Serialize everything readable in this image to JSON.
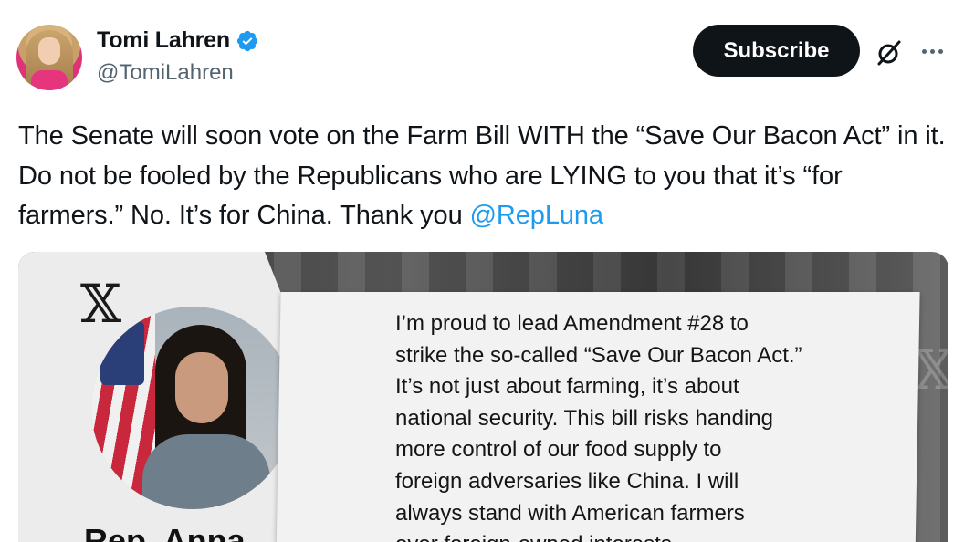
{
  "author": {
    "display_name": "Tomi Lahren",
    "handle": "@TomiLahren",
    "verified": true
  },
  "actions": {
    "subscribe_label": "Subscribe",
    "grok_icon": "grok-icon",
    "more_icon": "more-icon"
  },
  "tweet": {
    "text_before_mention": "The Senate will soon vote on the Farm Bill WITH the “Save Our Bacon Act” in it. Do not be fooled by the Republicans who are LYING to you that it’s “for farmers.” No. It’s for China. Thank you ",
    "mention": "@RepLuna"
  },
  "media": {
    "logo_text": "𝕏",
    "person_name_partial": "Rep. Anna",
    "quote": "I’m proud to lead Amendment #28 to\nstrike the so-called “Save Our Bacon Act.”\nIt’s not just about farming, it’s about\nnational security. This bill risks handing\nmore control of our food supply to\nforeign adversaries like China. I will\nalways stand with American farmers\nover foreign-owned interests."
  },
  "colors": {
    "link": "#1d9bf0",
    "verified": "#1d9bf0",
    "button_bg": "#0f1419",
    "secondary_text": "#536471"
  }
}
